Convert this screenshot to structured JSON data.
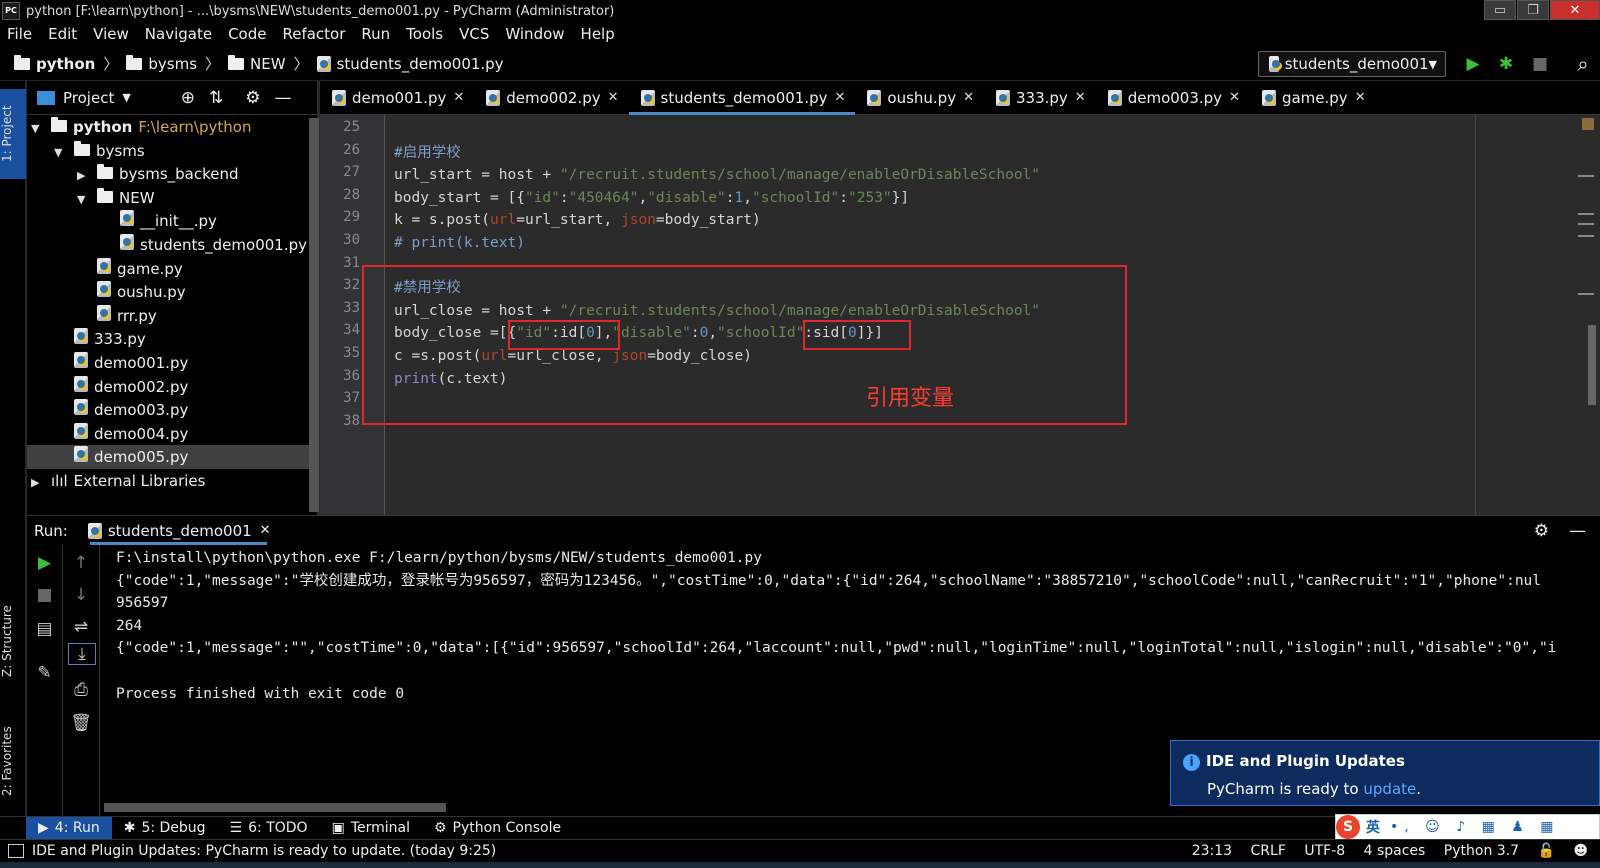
{
  "window": {
    "title": "python [F:\\learn\\python] - ...\\bysms\\NEW\\students_demo001.py - PyCharm (Administrator)",
    "app_icon": "PC",
    "controls": {
      "minimize": "▭",
      "restore": "❐",
      "close": "✕"
    }
  },
  "menu": [
    "File",
    "Edit",
    "View",
    "Navigate",
    "Code",
    "Refactor",
    "Run",
    "Tools",
    "VCS",
    "Window",
    "Help"
  ],
  "breadcrumb": [
    "python",
    "bysms",
    "NEW",
    "students_demo001.py"
  ],
  "run_config": {
    "name": "students_demo001",
    "arrow": "▼"
  },
  "toolbar_icons": {
    "run": "▶",
    "debug": "✱",
    "stop": "■",
    "search": "⌕"
  },
  "left_strip": {
    "project": "1: Project",
    "structure": "Z: Structure",
    "favorites": "2: Favorites"
  },
  "project_panel": {
    "title": "Project",
    "tree": [
      {
        "label": "python",
        "path": "F:\\learn\\python",
        "indent": 0,
        "arrow": "▼",
        "type": "folder"
      },
      {
        "label": "bysms",
        "indent": 1,
        "arrow": "▼",
        "type": "folder"
      },
      {
        "label": "bysms_backend",
        "indent": 2,
        "arrow": "▶",
        "type": "folder"
      },
      {
        "label": "NEW",
        "indent": 2,
        "arrow": "▼",
        "type": "folder"
      },
      {
        "label": "__init__.py",
        "indent": 3,
        "arrow": "",
        "type": "py"
      },
      {
        "label": "students_demo001.py",
        "indent": 3,
        "arrow": "",
        "type": "py"
      },
      {
        "label": "game.py",
        "indent": 2,
        "arrow": "",
        "type": "py"
      },
      {
        "label": "oushu.py",
        "indent": 2,
        "arrow": "",
        "type": "py"
      },
      {
        "label": "rrr.py",
        "indent": 2,
        "arrow": "",
        "type": "py"
      },
      {
        "label": "333.py",
        "indent": 1,
        "arrow": "",
        "type": "py"
      },
      {
        "label": "demo001.py",
        "indent": 1,
        "arrow": "",
        "type": "py"
      },
      {
        "label": "demo002.py",
        "indent": 1,
        "arrow": "",
        "type": "py"
      },
      {
        "label": "demo003.py",
        "indent": 1,
        "arrow": "",
        "type": "py"
      },
      {
        "label": "demo004.py",
        "indent": 1,
        "arrow": "",
        "type": "py"
      },
      {
        "label": "demo005.py",
        "indent": 1,
        "arrow": "",
        "type": "py",
        "selected": true
      },
      {
        "label": "External Libraries",
        "indent": 0,
        "arrow": "▶",
        "type": "lib"
      }
    ]
  },
  "editor_tabs": [
    {
      "label": "demo001.py"
    },
    {
      "label": "demo002.py"
    },
    {
      "label": "students_demo001.py",
      "active": true
    },
    {
      "label": "oushu.py"
    },
    {
      "label": "333.py"
    },
    {
      "label": "demo003.py"
    },
    {
      "label": "game.py"
    }
  ],
  "editor": {
    "lines": [
      {
        "n": "25",
        "code": []
      },
      {
        "n": "26",
        "code": [
          [
            "cm",
            "#启用学校"
          ]
        ]
      },
      {
        "n": "27",
        "code": [
          [
            "",
            "url_start = host + "
          ],
          [
            "str",
            "\"/recruit.students/school/manage/enableOrDisableSchool\""
          ]
        ]
      },
      {
        "n": "28",
        "code": [
          [
            "",
            "body_start = [{"
          ],
          [
            "str",
            "\"id\""
          ],
          [
            "",
            ":"
          ],
          [
            "str",
            "\"450464\""
          ],
          [
            "",
            ","
          ],
          [
            "str",
            "\"disable\""
          ],
          [
            "",
            ":"
          ],
          [
            "num",
            "1"
          ],
          [
            "",
            ","
          ],
          [
            "str",
            "\"schoolId\""
          ],
          [
            "",
            ":"
          ],
          [
            "str",
            "\"253\""
          ],
          [
            "",
            "}]"
          ]
        ]
      },
      {
        "n": "29",
        "code": [
          [
            "",
            "k = s.post("
          ],
          [
            "prm",
            "url"
          ],
          [
            "",
            "=url_start, "
          ],
          [
            "prm",
            "json"
          ],
          [
            "",
            "=body_start)"
          ]
        ]
      },
      {
        "n": "30",
        "code": [
          [
            "cm",
            "# print(k.text)"
          ]
        ]
      },
      {
        "n": "31",
        "code": []
      },
      {
        "n": "32",
        "code": [
          [
            "cm",
            "#禁用学校"
          ]
        ]
      },
      {
        "n": "33",
        "code": [
          [
            "",
            "url_close = host + "
          ],
          [
            "str",
            "\"/recruit.students/school/manage/enableOrDisableSchool\""
          ]
        ]
      },
      {
        "n": "34",
        "code": [
          [
            "",
            "body_close =[{"
          ],
          [
            "str",
            "\"id\""
          ],
          [
            "",
            ":id["
          ],
          [
            "num",
            "0"
          ],
          [
            "",
            "],"
          ],
          [
            "str",
            "\"disable\""
          ],
          [
            "",
            ":"
          ],
          [
            "num",
            "0"
          ],
          [
            "",
            ","
          ],
          [
            "str",
            "\"schoolId\""
          ],
          [
            "",
            ":sid["
          ],
          [
            "num",
            "0"
          ],
          [
            "",
            "]}]"
          ]
        ]
      },
      {
        "n": "35",
        "code": [
          [
            "",
            "c =s.post("
          ],
          [
            "prm",
            "url"
          ],
          [
            "",
            "=url_close, "
          ],
          [
            "prm",
            "json"
          ],
          [
            "",
            "=body_close)"
          ]
        ]
      },
      {
        "n": "36",
        "code": [
          [
            "fn",
            "print"
          ],
          [
            "",
            "(c.text)"
          ]
        ]
      },
      {
        "n": "37",
        "code": []
      },
      {
        "n": "38",
        "code": []
      }
    ],
    "annotation": "引用变量"
  },
  "run_panel": {
    "label": "Run:",
    "tab": "students_demo001",
    "output": [
      "F:\\install\\python\\python.exe F:/learn/python/bysms/NEW/students_demo001.py",
      "{\"code\":1,\"message\":\"学校创建成功，登录帐号为956597，密码为123456。\",\"costTime\":0,\"data\":{\"id\":264,\"schoolName\":\"38857210\",\"schoolCode\":null,\"canRecruit\":\"1\",\"phone\":nul",
      "956597",
      "264",
      "{\"code\":1,\"message\":\"\",\"costTime\":0,\"data\":[{\"id\":956597,\"schoolId\":264,\"laccount\":null,\"pwd\":null,\"loginTime\":null,\"loginTotal\":null,\"islogin\":null,\"disable\":\"0\",\"i",
      "",
      "Process finished with exit code 0"
    ]
  },
  "notification": {
    "title": "IDE and Plugin Updates",
    "body_prefix": "PyCharm is ready to ",
    "link": "update",
    "body_suffix": "."
  },
  "bottom_tabs": [
    {
      "label": "4: Run",
      "icon": "▶",
      "active": true
    },
    {
      "label": "5: Debug",
      "icon": "✱"
    },
    {
      "label": "6: TODO",
      "icon": "☰"
    },
    {
      "label": "Terminal",
      "icon": "▣"
    },
    {
      "label": "Python Console",
      "icon": "⚙"
    }
  ],
  "ime": {
    "logo": "S",
    "lang": "英",
    "icons": "•, ☺ ♪ ▦ ♟ ▦"
  },
  "status": {
    "message": "IDE and Plugin Updates: PyCharm is ready to update. (today 9:25)",
    "position": "23:13",
    "line_sep": "CRLF",
    "encoding": "UTF-8",
    "indent": "4 spaces",
    "interpreter": "Python 3.7"
  },
  "colors": {
    "accent": "#4a88c7",
    "highlight_box": "#e0272b",
    "notification_bg": "#0d2b5e",
    "run_green": "#3dbe3d"
  }
}
